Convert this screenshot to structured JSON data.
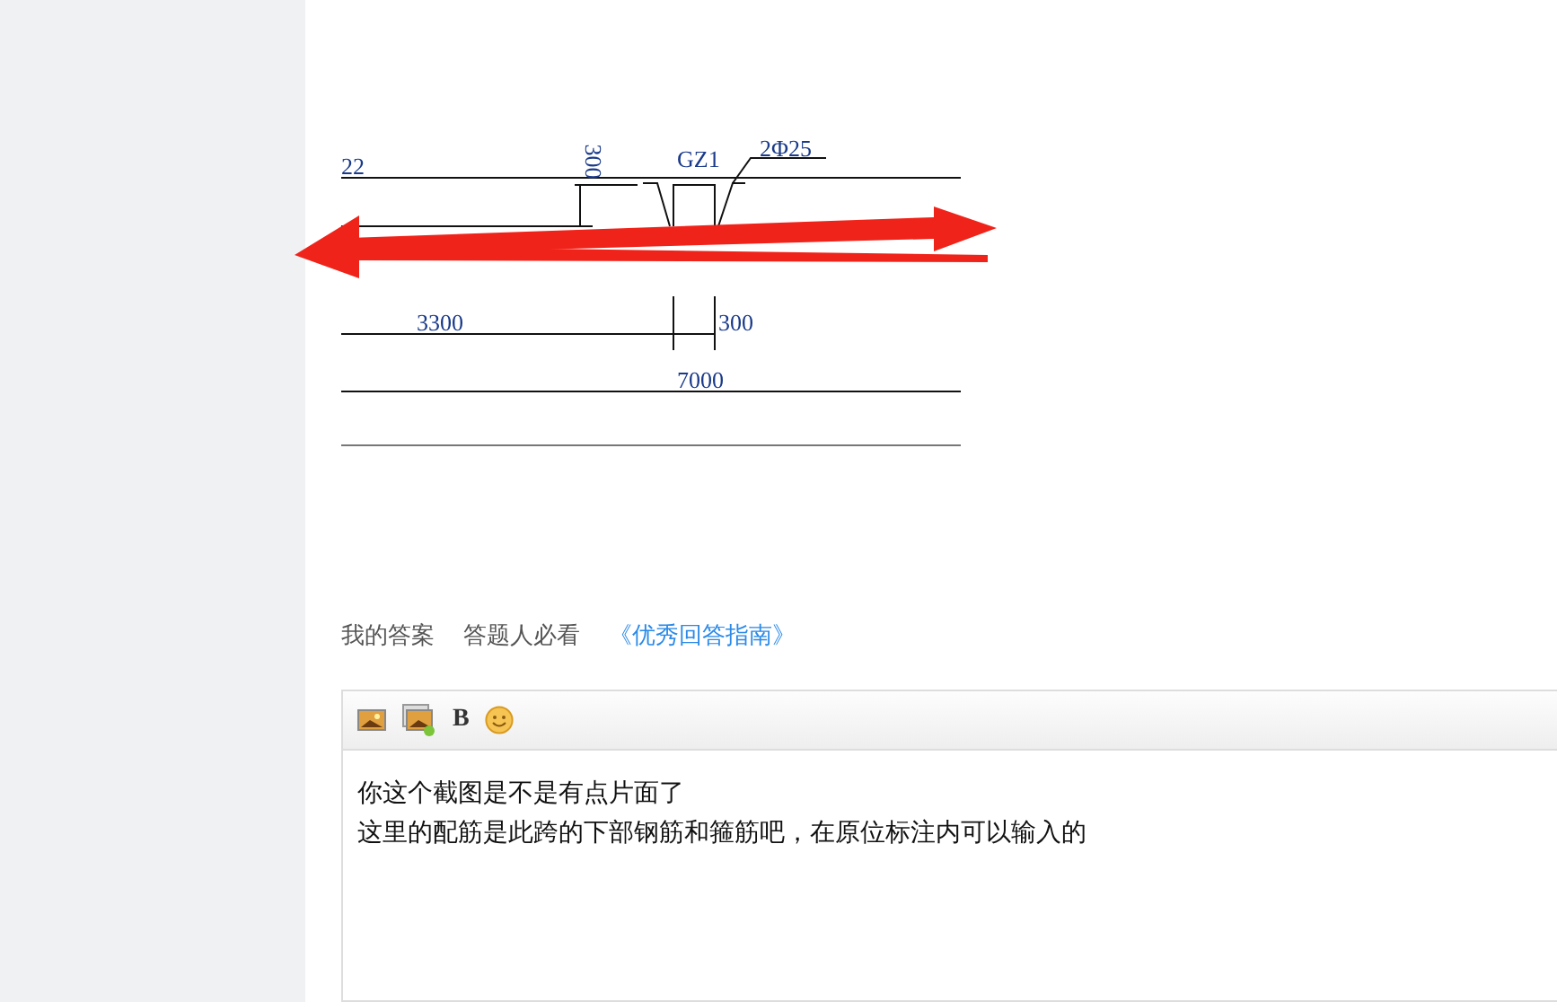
{
  "drawing": {
    "labels": [
      {
        "kind": "plain",
        "text": "22"
      },
      {
        "kind": "vertical",
        "text": "300"
      },
      {
        "kind": "plain",
        "text": "GZ1"
      },
      {
        "kind": "plain",
        "text": "2Φ25"
      },
      {
        "kind": "plain",
        "text": "3300"
      },
      {
        "kind": "plain",
        "text": "300"
      },
      {
        "kind": "plain",
        "text": "7000"
      }
    ]
  },
  "answer_links": [
    {
      "text": "我的答案",
      "kind": "plain"
    },
    {
      "text": "答题人必看",
      "kind": "plain"
    },
    {
      "text": "《优秀回答指南》",
      "kind": "link"
    }
  ],
  "editor": {
    "toolbar": [
      {
        "kind": "image"
      },
      {
        "kind": "images"
      },
      {
        "kind": "bold",
        "text": "B"
      },
      {
        "kind": "emoji"
      }
    ],
    "lines": [
      "你这个截图是不是有点片面了",
      "这里的配筋是此跨的下部钢筋和箍筋吧，在原位标注内可以输入的"
    ]
  }
}
